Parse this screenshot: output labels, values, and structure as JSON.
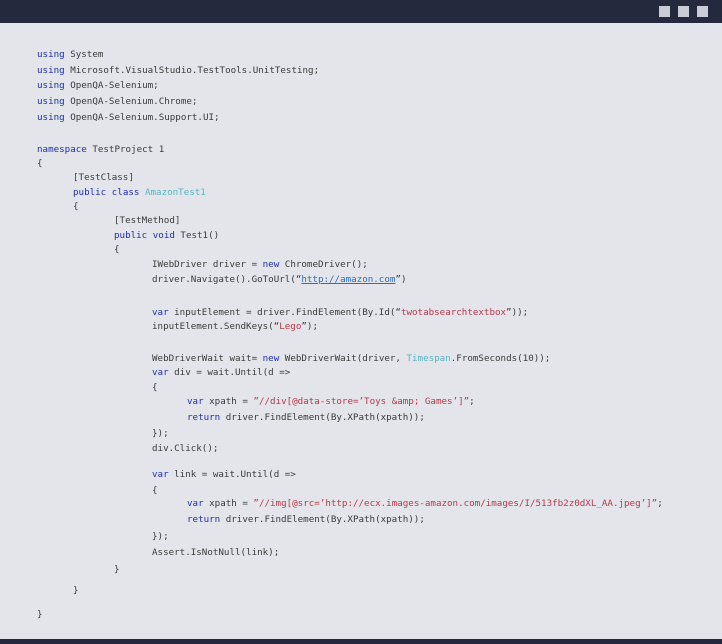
{
  "window": {
    "buttons": [
      "minimize",
      "maximize",
      "close"
    ]
  },
  "code": {
    "l1": [
      "using",
      " System"
    ],
    "l2": [
      "using",
      " Microsoft.VisualStudio.TestTools.UnitTesting;"
    ],
    "l3": [
      "using",
      " OpenQA-Selenium;"
    ],
    "l4": [
      "using",
      " OpenQA-Selenium.Chrome;"
    ],
    "l5": [
      "using",
      " OpenQA-Selenium.Support.UI;"
    ],
    "l6": [
      "namespace",
      " TestProject 1"
    ],
    "l7": "{",
    "l8": "[TestClass]",
    "l9": [
      "public",
      " ",
      "class",
      " ",
      "AmazonTest1"
    ],
    "l10": "{",
    "l11": "[TestMethod]",
    "l12": [
      "public",
      " ",
      "void",
      " Test1()"
    ],
    "l13": "{",
    "l14": [
      "IWebDriver driver = ",
      "new",
      " ChromeDriver();"
    ],
    "l15": [
      "driver.Navigate().GoToUrl(“",
      "http://amazon.com",
      "”)"
    ],
    "l16": [
      "var",
      " inputElement = driver.FindElement(By.Id(“",
      "twotabsearchtextbox",
      "”));"
    ],
    "l17": [
      "inputElement.SendKeys(“",
      "Lego",
      "”);"
    ],
    "l18": [
      "WebDriverWait wait= ",
      "new",
      " WebDriverWait(driver, ",
      "Timespan",
      ".FromSeconds(10));"
    ],
    "l19": [
      "var",
      " div = wait.Until(d =>"
    ],
    "l20": "{",
    "l21": [
      "var",
      " xpath = ",
      "”//div[@data-store=’Toys &amp; Games’]”",
      ";"
    ],
    "l22": [
      "return",
      " driver.FindElement(By.XPath(xpath));"
    ],
    "l23": "});",
    "l24": "div.Click();",
    "l25": [
      "var",
      " link = wait.Until(d =>"
    ],
    "l26": "{",
    "l27": [
      "var",
      " xpath = ",
      "”//img[@src=’http://ecx.images-amazon.com/images/I/513fb2z0dXL_AA.jpeg’]”",
      ";"
    ],
    "l28": [
      "return",
      " driver.FindElement(By.XPath(xpath));"
    ],
    "l29": "});",
    "l30": "Assert.IsNotNull(link);",
    "l31": "}",
    "l32": "}",
    "l33": "}"
  }
}
